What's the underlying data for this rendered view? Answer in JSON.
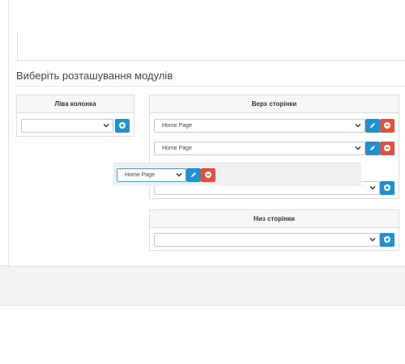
{
  "section": {
    "title": "Виберіть розташування модулів"
  },
  "left_column": {
    "heading": "Ліва колонка",
    "select_value": ""
  },
  "top_page": {
    "heading": "Верх сторінки",
    "rows": [
      {
        "value": "Home Page"
      },
      {
        "value": "Home Page"
      }
    ],
    "add_select_value": ""
  },
  "dragging_row": {
    "value": "Home Page"
  },
  "bottom_page": {
    "heading": "Низ сторінки",
    "select_value": ""
  },
  "colors": {
    "primary": "#1e91cf",
    "danger": "#e3503e"
  },
  "icons": {
    "add": "plus-circle-icon",
    "edit": "pencil-icon",
    "remove": "minus-circle-icon",
    "dropdown": "chevron-down-icon"
  }
}
